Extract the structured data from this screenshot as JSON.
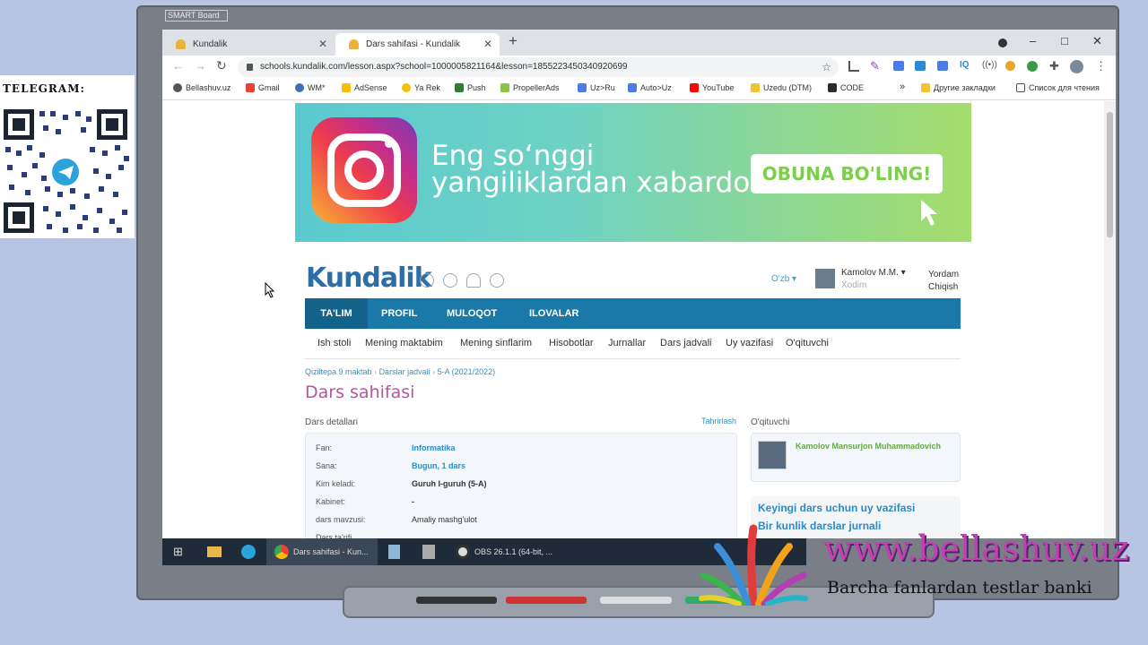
{
  "telegram": {
    "label": "TELEGRAM:"
  },
  "smartboard": {
    "brand": "SMART Board"
  },
  "browser": {
    "tabs": [
      {
        "title": "Kundalik"
      },
      {
        "title": "Dars sahifasi - Kundalik"
      }
    ],
    "new_tab": "+",
    "window_controls": [
      "–",
      "□",
      "✕"
    ],
    "url": "schools.kundalik.com/lesson.aspx?school=1000005821164&lesson=1855223450340920699",
    "bookmarks": [
      {
        "label": "Bellashuv.uz",
        "color": "#555555"
      },
      {
        "label": "Gmail",
        "color": "#ea4335"
      },
      {
        "label": "WM*",
        "color": "#3b6fb6"
      },
      {
        "label": "AdSense",
        "color": "#fbbc04"
      },
      {
        "label": "Ya Rek",
        "color": "#f2c200"
      },
      {
        "label": "Push",
        "color": "#2e7d32"
      },
      {
        "label": "PropellerAds",
        "color": "#8bc34a"
      },
      {
        "label": "Uz>Ru",
        "color": "#4a7ce8"
      },
      {
        "label": "Auto>Uz",
        "color": "#4a7ce8"
      },
      {
        "label": "YouTube",
        "color": "#ff0000"
      },
      {
        "label": "Uzedu (DTM)",
        "color": "#f4c430"
      },
      {
        "label": "CODE",
        "color": "#2b2b2b"
      }
    ],
    "bookmarks_more": "»",
    "other_bookmarks": "Другие закладки",
    "reading_list": "Список для чтения"
  },
  "banner": {
    "text": "Eng so‘nggi\nyangiliklardan xabardor",
    "button": "OBUNA BO'LING!"
  },
  "kundalik": {
    "logo": "Kundalik",
    "language": "O'zb ▾",
    "user_name": "Kamolov M.M. ▾",
    "user_role": "Xodim",
    "help": "Yordam",
    "logout": "Chiqish",
    "nav": [
      "TA'LIM",
      "PROFIL",
      "MULOQOT",
      "ILOVALAR"
    ],
    "subnav": [
      "Ish stoli",
      "Mening maktabim",
      "Mening sinflarim",
      "Hisobotlar",
      "Jurnallar",
      "Dars jadvali",
      "Uy vazifasi",
      "O'qituvchi"
    ],
    "breadcrumb": [
      "Qiziltepa 9 maktab",
      "Darslar jadvali",
      "5-A (2021/2022)"
    ],
    "page_title": "Dars sahifasi",
    "details_label": "Dars detallari",
    "edit_link": "Tahrirlash",
    "details": [
      {
        "key": "Fan:",
        "value": "Informatika",
        "style": "blue"
      },
      {
        "key": "Sana:",
        "value": "Bugun, 1 dars",
        "style": "blue"
      },
      {
        "key": "Kim keladi:",
        "value": "Guruh I-guruh (5-A)",
        "style": "plain"
      },
      {
        "key": "Kabinet:",
        "value": "-",
        "style": "plain"
      },
      {
        "key": "dars mavzusi:",
        "value": "Amaliy mashg'ulot",
        "style": "plain"
      },
      {
        "key": "Dars ta'rifi",
        "value": "",
        "style": "plain"
      }
    ],
    "teacher_label": "O'qituvchi",
    "teacher_name": "Kamolov Mansurjon Muhammadovich",
    "homework_next": "Keyingi dars uchun uy vazifasi",
    "daily_journal": "Bir kunlik darslar jurnali"
  },
  "taskbar": {
    "chrome": "Dars sahifasi - Kun...",
    "obs": "OBS 26.1.1 (64-bit, ..."
  },
  "branding": {
    "site": "www.bellashuv.uz",
    "tagline": "Barcha fanlardan testlar banki"
  }
}
